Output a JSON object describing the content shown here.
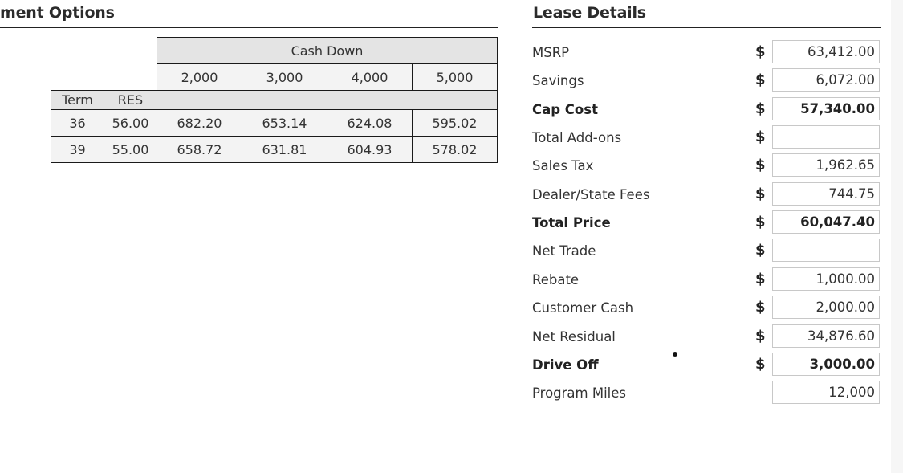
{
  "payment_options": {
    "title": "ment Options",
    "cash_down_header": "Cash Down",
    "cash_down_amounts": [
      "2,000",
      "3,000",
      "4,000",
      "5,000"
    ],
    "term_header": "Term",
    "res_header": "RES",
    "rows": [
      {
        "term": "36",
        "res": "56.00",
        "payments": [
          "682.20",
          "653.14",
          "624.08",
          "595.02"
        ]
      },
      {
        "term": "39",
        "res": "55.00",
        "payments": [
          "658.72",
          "631.81",
          "604.93",
          "578.02"
        ]
      }
    ]
  },
  "lease_details": {
    "title": "Lease Details",
    "currency_symbol": "$",
    "rows": [
      {
        "label": "MSRP",
        "value": "63,412.00",
        "bold": false,
        "currency": true
      },
      {
        "label": "Savings",
        "value": "6,072.00",
        "bold": false,
        "currency": true
      },
      {
        "label": "Cap Cost",
        "value": "57,340.00",
        "bold": true,
        "currency": true
      },
      {
        "label": "Total Add-ons",
        "value": "",
        "bold": false,
        "currency": true
      },
      {
        "label": "Sales Tax",
        "value": "1,962.65",
        "bold": false,
        "currency": true
      },
      {
        "label": "Dealer/State Fees",
        "value": "744.75",
        "bold": false,
        "currency": true
      },
      {
        "label": "Total Price",
        "value": "60,047.40",
        "bold": true,
        "currency": true
      },
      {
        "label": "Net Trade",
        "value": "",
        "bold": false,
        "currency": true
      },
      {
        "label": "Rebate",
        "value": "1,000.00",
        "bold": false,
        "currency": true
      },
      {
        "label": "Customer Cash",
        "value": "2,000.00",
        "bold": false,
        "currency": true
      },
      {
        "label": "Net Residual",
        "value": "34,876.60",
        "bold": false,
        "currency": true
      },
      {
        "label": "Drive Off",
        "value": "3,000.00",
        "bold": true,
        "currency": true
      },
      {
        "label": "Program Miles",
        "value": "12,000",
        "bold": false,
        "currency": false
      }
    ]
  }
}
